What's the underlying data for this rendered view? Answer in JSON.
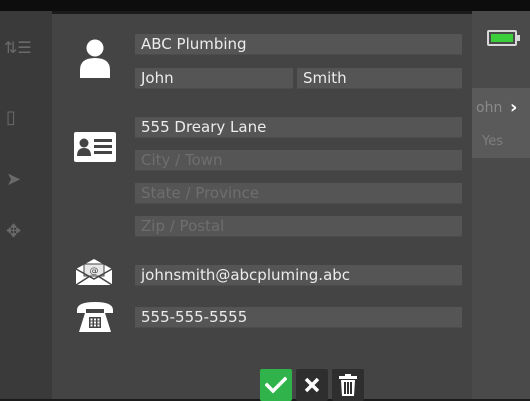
{
  "background": {
    "right_panel_name": "ohn",
    "right_panel_value": "Yes"
  },
  "contact": {
    "company": {
      "value": "ABC Plumbing",
      "placeholder": ""
    },
    "first_name": {
      "value": "John",
      "placeholder": ""
    },
    "last_name": {
      "value": "Smith",
      "placeholder": ""
    },
    "street": {
      "value": "555 Dreary Lane",
      "placeholder": ""
    },
    "city": {
      "value": "",
      "placeholder": "City / Town"
    },
    "state": {
      "value": "",
      "placeholder": "State / Province"
    },
    "zip": {
      "value": "",
      "placeholder": "Zip / Postal"
    },
    "email": {
      "value": "johnsmith@abcpluming.abc",
      "placeholder": ""
    },
    "phone": {
      "value": "555-555-5555",
      "placeholder": ""
    }
  },
  "icons": {
    "person": "person-icon",
    "address_card": "address-card-icon",
    "email": "envelope-icon",
    "phone": "telephone-icon",
    "confirm": "checkmark-icon",
    "cancel": "close-icon",
    "delete": "trash-icon",
    "battery": "battery-icon"
  },
  "colors": {
    "dialog_bg": "#444444",
    "field_bg": "#555555",
    "field_text": "#ececec",
    "placeholder_text": "#6e6e6e",
    "confirm_green": "#2fb34a",
    "battery_green": "#3ccf3c"
  }
}
